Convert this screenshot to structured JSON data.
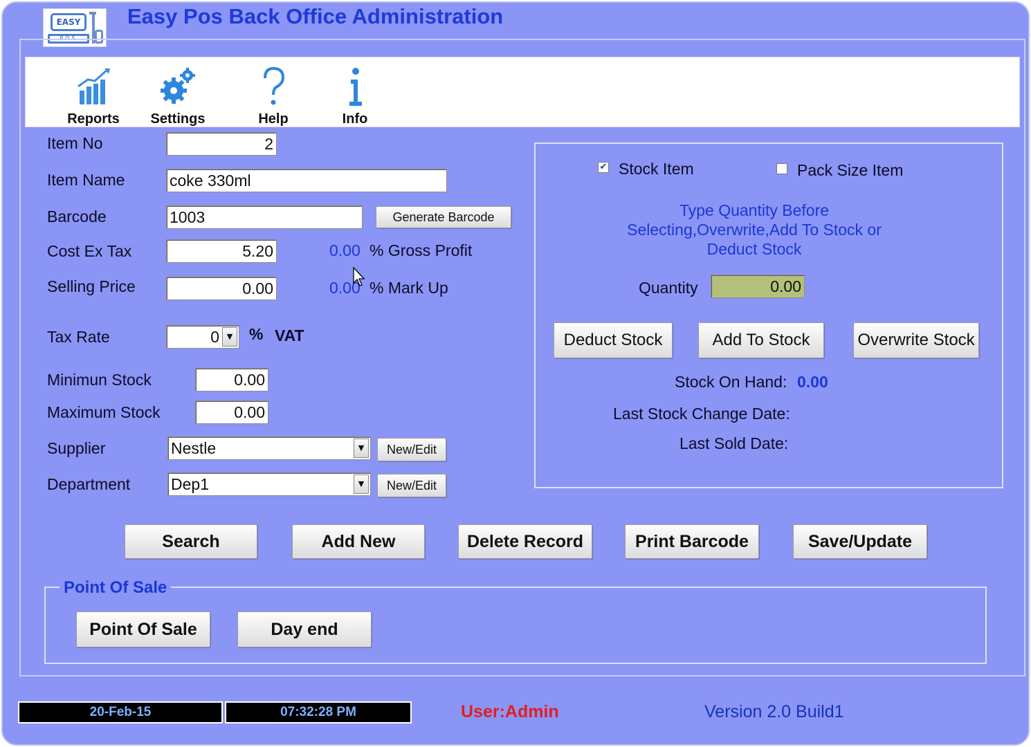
{
  "window": {
    "title": "Easy Pos Back Office Administration",
    "logo": {
      "screen_text": "EASY",
      "base_text": "POS"
    }
  },
  "toolbar": {
    "items": [
      {
        "label": "Reports",
        "icon": "bar-chart-icon"
      },
      {
        "label": "Settings",
        "icon": "gears-icon"
      },
      {
        "label": "Help",
        "icon": "question-mark-icon"
      },
      {
        "label": "Info",
        "icon": "info-icon"
      }
    ]
  },
  "item_form": {
    "item_no": {
      "label": "Item No",
      "value": "2"
    },
    "item_name": {
      "label": "Item Name",
      "value": "coke 330ml"
    },
    "barcode": {
      "label": "Barcode",
      "value": "1003",
      "generate_label": "Generate Barcode"
    },
    "cost_ex_tax": {
      "label": "Cost Ex Tax",
      "value": "5.20",
      "gross_profit_value": "0.00",
      "gross_profit_label": "% Gross Profit"
    },
    "selling_price": {
      "label": "Selling Price",
      "value": "0.00",
      "markup_value": "0.00",
      "markup_label": "% Mark Up"
    },
    "tax_rate": {
      "label": "Tax Rate",
      "value": "0",
      "percent": "%",
      "vat_label": "VAT"
    },
    "minimum_stock": {
      "label": "Minimun Stock",
      "value": "0.00"
    },
    "maximum_stock": {
      "label": "Maximum Stock",
      "value": "0.00"
    },
    "supplier": {
      "label": "Supplier",
      "value": "Nestle",
      "edit_label": "New/Edit"
    },
    "department": {
      "label": "Department",
      "value": "Dep1",
      "edit_label": "New/Edit"
    }
  },
  "stock_panel": {
    "stock_item": {
      "label": "Stock Item",
      "checked": true
    },
    "pack_size_item": {
      "label": "Pack Size Item",
      "checked": false
    },
    "note_lines": [
      "Type Quantity Before",
      "Selecting,Overwrite,Add To Stock or",
      "Deduct Stock"
    ],
    "quantity": {
      "label": "Quantity",
      "value": "0.00"
    },
    "buttons": {
      "deduct": "Deduct Stock",
      "add": "Add To Stock",
      "overwrite": "Overwrite Stock"
    },
    "stock_on_hand": {
      "label": "Stock On Hand:",
      "value": "0.00"
    },
    "last_stock_change_label": "Last Stock Change Date:",
    "last_sold_label": "Last Sold Date:"
  },
  "actions": {
    "search": "Search",
    "add_new": "Add New",
    "delete_record": "Delete Record",
    "print_barcode": "Print Barcode",
    "save_update": "Save/Update"
  },
  "point_of_sale": {
    "group_title": "Point Of Sale",
    "pos_button": "Point Of Sale",
    "day_end_button": "Day end"
  },
  "status_bar": {
    "date": "20-Feb-15",
    "time": "07:32:28 PM",
    "user": "User:Admin",
    "version": "Version 2.0 Build1"
  },
  "colors": {
    "background": "#8b95f5",
    "title": "#1e3ad8",
    "accent_text": "#1b37d6",
    "quantity_field": "#b3c07a",
    "user_text": "#e02020"
  }
}
